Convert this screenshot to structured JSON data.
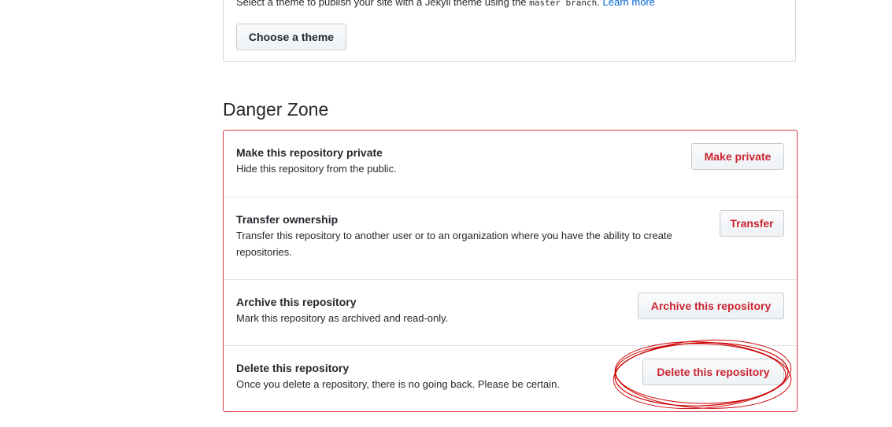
{
  "pages_section": {
    "description_prefix": "Select a theme to publish your site with a Jekyll theme using the",
    "branch": "master branch",
    "description_suffix": ".",
    "learn_more": "Learn more",
    "choose_theme_button": "Choose a theme"
  },
  "danger_zone": {
    "title": "Danger Zone",
    "items": [
      {
        "title": "Make this repository private",
        "description": "Hide this repository from the public.",
        "button": "Make private"
      },
      {
        "title": "Transfer ownership",
        "description": "Transfer this repository to another user or to an organization where you have the ability to create repositories.",
        "button": "Transfer"
      },
      {
        "title": "Archive this repository",
        "description": "Mark this repository as archived and read-only.",
        "button": "Archive this repository"
      },
      {
        "title": "Delete this repository",
        "description": "Once you delete a repository, there is no going back. Please be certain.",
        "button": "Delete this repository"
      }
    ]
  },
  "colors": {
    "danger": "#cb2431",
    "danger_border": "#d73a49",
    "link": "#0366d6",
    "annotation": "#cc0000"
  }
}
